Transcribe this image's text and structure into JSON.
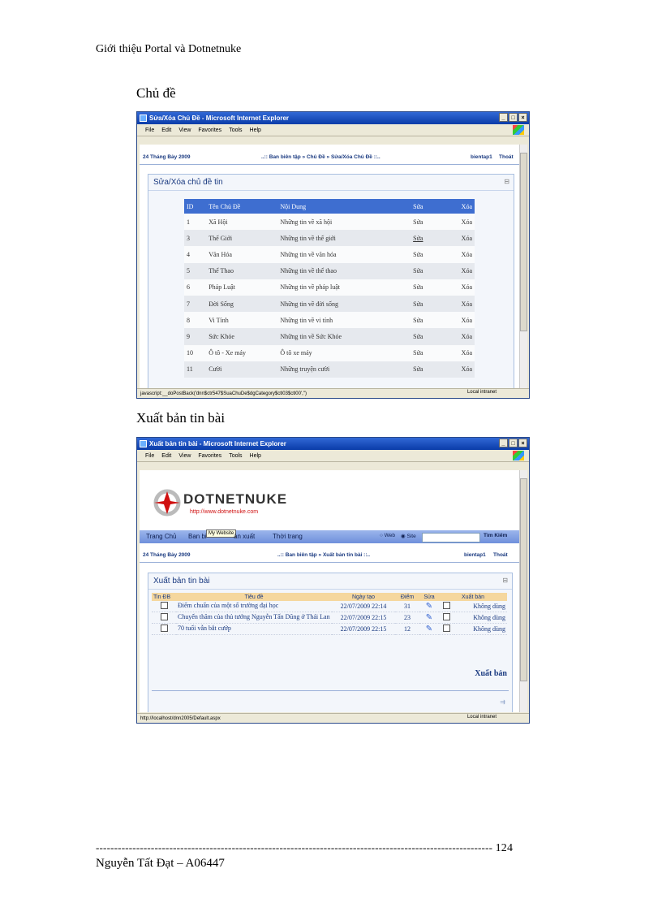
{
  "doc": {
    "header": "Giới thiệu Portal và Dotnetnuke",
    "heading1": "Chủ đề",
    "heading2": "Xuất bản tin bài",
    "page_number": "124",
    "footer_rule": "------------------------------------------------------------------------------------------------------------",
    "author": "Nguyễn Tất Đạt – A06447"
  },
  "window1": {
    "title": "Sửa/Xóa Chủ Đề - Microsoft Internet Explorer",
    "menu": [
      "File",
      "Edit",
      "View",
      "Favorites",
      "Tools",
      "Help"
    ],
    "date": "24 Tháng Bảy 2009",
    "breadcrumb": "..:: Ban biên tập » Chủ Đề » Sửa/Xóa Chủ Đề ::..",
    "user": "bientap1",
    "logout": "Thoát",
    "module_title": "Sửa/Xóa chủ đề tin",
    "columns": [
      "ID",
      "Tên Chủ Đề",
      "Nội Dung",
      "Sửa",
      "Xóa"
    ],
    "rows": [
      {
        "id": "1",
        "name": "Xã Hội",
        "desc": "Những tin về xã hội",
        "edit": "Sửa",
        "del": "Xóa"
      },
      {
        "id": "3",
        "name": "Thế Giới",
        "desc": "Những tin về thế giới",
        "edit": "Sửa",
        "del": "Xóa"
      },
      {
        "id": "4",
        "name": "Văn Hóa",
        "desc": "Những tin về văn hóa",
        "edit": "Sửa",
        "del": "Xóa"
      },
      {
        "id": "5",
        "name": "Thể Thao",
        "desc": "Những tin về thể thao",
        "edit": "Sửa",
        "del": "Xóa"
      },
      {
        "id": "6",
        "name": "Pháp Luật",
        "desc": "Những tin về pháp luật",
        "edit": "Sửa",
        "del": "Xóa"
      },
      {
        "id": "7",
        "name": "Đời Sống",
        "desc": "Những tin về đời sống",
        "edit": "Sửa",
        "del": "Xóa"
      },
      {
        "id": "8",
        "name": "Vi Tính",
        "desc": "Những tin về vi tính",
        "edit": "Sửa",
        "del": "Xóa"
      },
      {
        "id": "9",
        "name": "Sức Khỏe",
        "desc": "Những tin về Sức Khỏe",
        "edit": "Sửa",
        "del": "Xóa"
      },
      {
        "id": "10",
        "name": "Ô tô - Xe máy",
        "desc": "Ô tô xe máy",
        "edit": "Sửa",
        "del": "Xóa"
      },
      {
        "id": "11",
        "name": "Cười",
        "desc": "Những truyện cười",
        "edit": "Sửa",
        "del": "Xóa"
      }
    ],
    "status": "javascript:__doPostBack('dnn$ctr547$SuaChuDe$dgCategory$ctl03$ctl00','')",
    "zone": "Local intranet"
  },
  "window2": {
    "title": "Xuất bản tin bài - Microsoft Internet Explorer",
    "menu": [
      "File",
      "Edit",
      "View",
      "Favorites",
      "Tools",
      "Help"
    ],
    "logo": "DOTNETNUKE",
    "logo_url": "http://www.dotnetnuke.com",
    "nav": [
      "Trang Chủ",
      "Ban biên tập",
      "Xuất bản",
      "Thời trang"
    ],
    "nav_ban_bien": "Ban bi",
    "nav_xuat_ban": "ản xuất",
    "tooltip": "My Website",
    "search_web": "Web",
    "search_site": "Site",
    "search_button": "Tìm Kiếm",
    "date": "24 Tháng Bảy 2009",
    "breadcrumb": "..:: Ban biên tập » Xuất bản tin bài ::..",
    "user": "bientap1",
    "logout": "Thoát",
    "module_title": "Xuất bản tin bài",
    "columns": [
      "Tin ĐB",
      "Tiêu đề",
      "Ngày tạo",
      "Điểm",
      "Sửa",
      "Xuất bản"
    ],
    "rows": [
      {
        "title": "Điểm chuẩn của một số trường đại học",
        "date": "22/07/2009 22:14",
        "score": "31",
        "status": "Không dùng"
      },
      {
        "title": "Chuyến thăm của thủ tướng Nguyễn Tấn Dũng ở Thái Lan",
        "date": "22/07/2009 22:15",
        "score": "23",
        "status": "Không dùng"
      },
      {
        "title": "70 tuổi vẫn bắt cướp",
        "date": "22/07/2009 22:15",
        "score": "12",
        "status": "Không dùng"
      }
    ],
    "publish_button": "Xuất bản",
    "status": "http://localhost/dnn2005/Default.aspx",
    "zone": "Local intranet"
  }
}
